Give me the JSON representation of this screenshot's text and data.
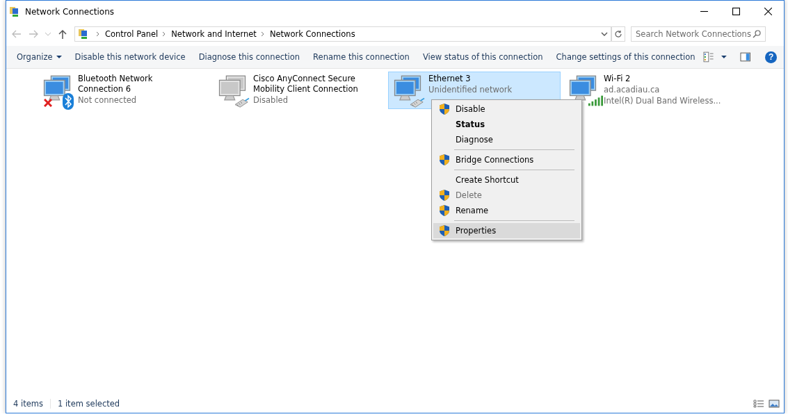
{
  "window": {
    "title": "Network Connections"
  },
  "address_bar": {
    "breadcrumbs": [
      "Control Panel",
      "Network and Internet",
      "Network Connections"
    ]
  },
  "search": {
    "placeholder": "Search Network Connections"
  },
  "toolbar": {
    "buttons": [
      {
        "label": "Organize",
        "dropdown": true
      },
      {
        "label": "Disable this network device",
        "dropdown": false
      },
      {
        "label": "Diagnose this connection",
        "dropdown": false
      },
      {
        "label": "Rename this connection",
        "dropdown": false
      },
      {
        "label": "View status of this connection",
        "dropdown": false
      },
      {
        "label": "Change settings of this connection",
        "dropdown": false
      }
    ],
    "help": "?"
  },
  "connections": [
    {
      "name": "Bluetooth Network Connection 6",
      "lines": [
        "Not connected"
      ],
      "kind": "bluetooth",
      "disabled": false,
      "error": true,
      "selected": false
    },
    {
      "name": "Cisco AnyConnect Secure Mobility Client Connection",
      "lines": [
        "Disabled"
      ],
      "kind": "cable",
      "disabled": true,
      "error": false,
      "selected": false
    },
    {
      "name": "Ethernet 3",
      "lines": [
        "Unidentified network"
      ],
      "kind": "cable",
      "disabled": false,
      "error": false,
      "selected": true
    },
    {
      "name": "Wi-Fi 2",
      "lines": [
        "ad.acadiau.ca",
        "Intel(R) Dual Band Wireless..."
      ],
      "kind": "wifi",
      "disabled": false,
      "error": false,
      "selected": false
    }
  ],
  "context_menu": {
    "items": [
      {
        "kind": "command",
        "label": "Disable",
        "shield": true,
        "bold": false,
        "disabled": false,
        "selected": false
      },
      {
        "kind": "command",
        "label": "Status",
        "shield": false,
        "bold": true,
        "disabled": false,
        "selected": false
      },
      {
        "kind": "command",
        "label": "Diagnose",
        "shield": false,
        "bold": false,
        "disabled": false,
        "selected": false
      },
      {
        "kind": "separator"
      },
      {
        "kind": "command",
        "label": "Bridge Connections",
        "shield": true,
        "bold": false,
        "disabled": false,
        "selected": false
      },
      {
        "kind": "separator"
      },
      {
        "kind": "command",
        "label": "Create Shortcut",
        "shield": false,
        "bold": false,
        "disabled": false,
        "selected": false
      },
      {
        "kind": "command",
        "label": "Delete",
        "shield": true,
        "bold": false,
        "disabled": true,
        "selected": false
      },
      {
        "kind": "command",
        "label": "Rename",
        "shield": true,
        "bold": false,
        "disabled": false,
        "selected": false
      },
      {
        "kind": "separator"
      },
      {
        "kind": "command",
        "label": "Properties",
        "shield": true,
        "bold": false,
        "disabled": false,
        "selected": true
      }
    ]
  },
  "status_bar": {
    "item_count": "4 items",
    "selection": "1 item selected"
  }
}
